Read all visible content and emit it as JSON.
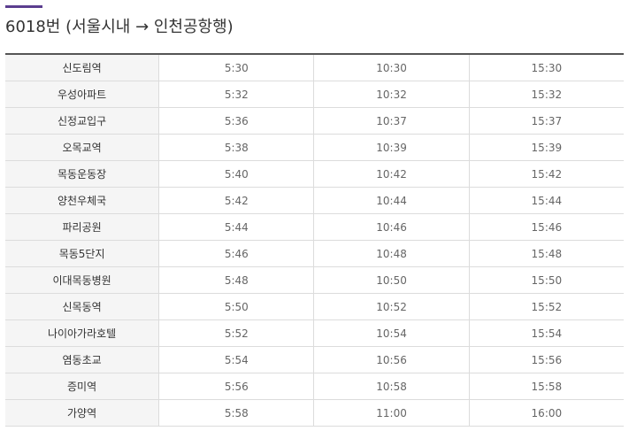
{
  "header": {
    "title": "6018번 (서울시내 → 인천공항행)",
    "accent_color": "#5b3d8f"
  },
  "schedule": {
    "rows": [
      {
        "stop": "신도림역",
        "times": [
          "5:30",
          "10:30",
          "15:30"
        ]
      },
      {
        "stop": "우성아파트",
        "times": [
          "5:32",
          "10:32",
          "15:32"
        ]
      },
      {
        "stop": "신정교입구",
        "times": [
          "5:36",
          "10:37",
          "15:37"
        ]
      },
      {
        "stop": "오목교역",
        "times": [
          "5:38",
          "10:39",
          "15:39"
        ]
      },
      {
        "stop": "목동운동장",
        "times": [
          "5:40",
          "10:42",
          "15:42"
        ]
      },
      {
        "stop": "양천우체국",
        "times": [
          "5:42",
          "10:44",
          "15:44"
        ]
      },
      {
        "stop": "파리공원",
        "times": [
          "5:44",
          "10:46",
          "15:46"
        ]
      },
      {
        "stop": "목동5단지",
        "times": [
          "5:46",
          "10:48",
          "15:48"
        ]
      },
      {
        "stop": "이대목동병원",
        "times": [
          "5:48",
          "10:50",
          "15:50"
        ]
      },
      {
        "stop": "신목동역",
        "times": [
          "5:50",
          "10:52",
          "15:52"
        ]
      },
      {
        "stop": "나이아가라호텔",
        "times": [
          "5:52",
          "10:54",
          "15:54"
        ]
      },
      {
        "stop": "염동초교",
        "times": [
          "5:54",
          "10:56",
          "15:56"
        ]
      },
      {
        "stop": "증미역",
        "times": [
          "5:56",
          "10:58",
          "15:58"
        ]
      },
      {
        "stop": "가양역",
        "times": [
          "5:58",
          "11:00",
          "16:00"
        ]
      }
    ]
  }
}
